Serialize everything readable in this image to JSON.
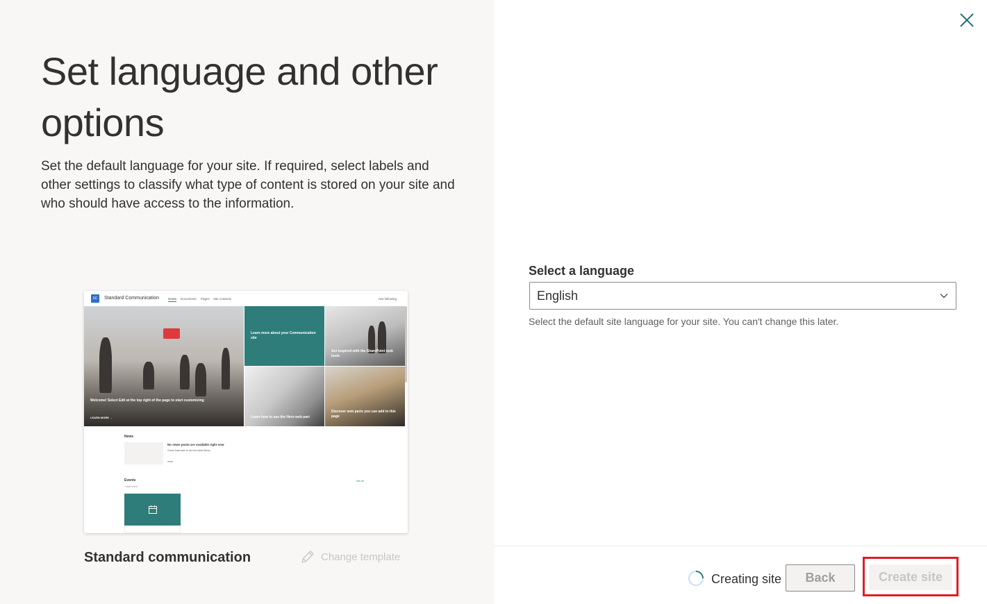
{
  "left": {
    "title": "Set language and other options",
    "description": "Set the default language for your site. If required, select labels and other settings to classify what type of content is stored on your site and who should have access to the information.",
    "template_name": "Standard communication",
    "change_template_label": "Change template",
    "preview": {
      "logo_text": "SC",
      "site_name": "Standard Communication",
      "nav": [
        "Home",
        "Documents",
        "Pages",
        "Site contents"
      ],
      "follow_label": "Not following",
      "hero_main_title": "Welcome! Select Edit at the top right of the page to start customizing",
      "hero_main_link": "LEARN MORE →",
      "hero_tile_teal": "Learn more about your Communication site",
      "hero_tile_2": "Get inspired with the SharePoint look book",
      "hero_tile_3": "Learn how to use the Hero web part",
      "hero_tile_4": "Discover web parts you can add to this page",
      "news_heading": "News",
      "news_empty_title": "No news posts are available right now",
      "news_empty_sub": "Check back later to see the latest News.",
      "news_more": "more",
      "events_heading": "Events",
      "add_event": "+ Add event",
      "see_all": "See all"
    }
  },
  "right": {
    "language_label": "Select a language",
    "language_value": "English",
    "language_help": "Select the default site language for your site. You can't change this later.",
    "status_text": "Creating site",
    "back_label": "Back",
    "create_label": "Create site"
  },
  "colors": {
    "accent_teal": "#2e7d7b",
    "highlight_red": "#e21b23",
    "left_bg": "#f8f7f6"
  }
}
